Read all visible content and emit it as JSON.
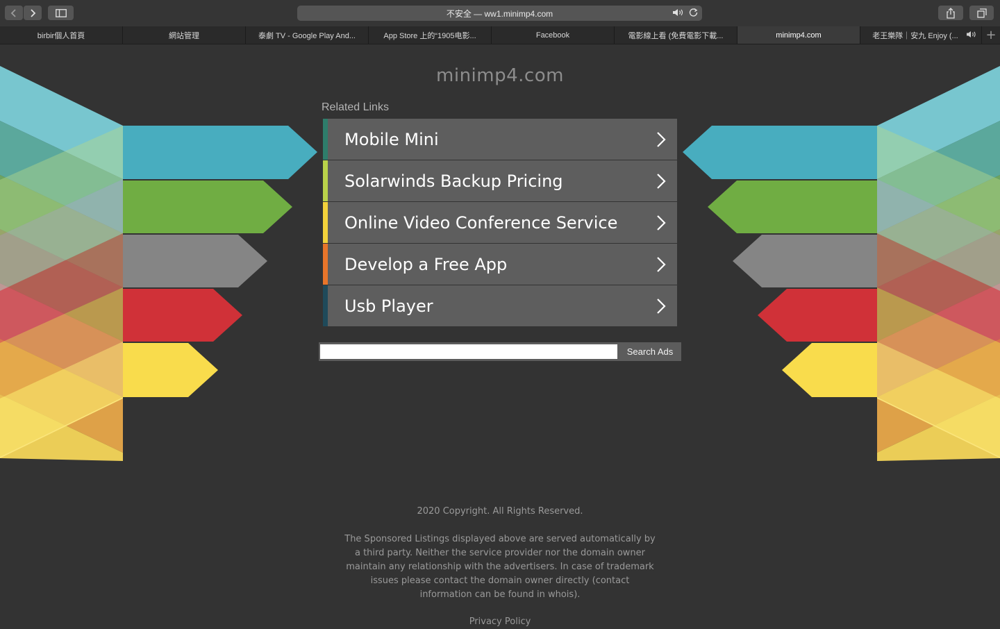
{
  "browser": {
    "address_text": "不安全 — ww1.minimp4.com",
    "tabs": [
      {
        "label": "birbir個人首頁"
      },
      {
        "label": "網站管理"
      },
      {
        "label": "泰劇 TV - Google Play And..."
      },
      {
        "label": "App Store 上的“1905电影..."
      },
      {
        "label": "Facebook"
      },
      {
        "label": "電影線上看 (免費電影下載..."
      },
      {
        "label": "minimp4.com"
      },
      {
        "label": "老王樂隊｜安九 Enjoy (..."
      }
    ],
    "active_tab_index": 6,
    "new_tab_symbol": "+"
  },
  "page": {
    "site_title": "minimp4.com",
    "related_label": "Related Links",
    "links": [
      {
        "label": "Mobile Mini",
        "color": "#2e7d6b"
      },
      {
        "label": "Solarwinds Backup Pricing",
        "color": "#b9d24a"
      },
      {
        "label": "Online Video Conference Service",
        "color": "#f3d23b"
      },
      {
        "label": "Develop a Free App",
        "color": "#e8752a"
      },
      {
        "label": "Usb Player",
        "color": "#1f4a5a"
      }
    ],
    "search": {
      "button_label": "Search Ads",
      "value": ""
    },
    "footer": {
      "copyright": "2020 Copyright. All Rights Reserved.",
      "disclaimer": "The Sponsored Listings displayed above are served automatically by a third party. Neither the service provider nor the domain owner maintain any relationship with the advertisers. In case of trademark issues please contact the domain owner directly (contact information can be found in whois).",
      "privacy": "Privacy Policy"
    }
  },
  "colors": {
    "background": "#333333",
    "ribbon_teal": "#48adbf",
    "ribbon_green": "#70ad43",
    "ribbon_gray": "#858585",
    "ribbon_red": "#d03138",
    "ribbon_yellow": "#f9dc4c"
  }
}
